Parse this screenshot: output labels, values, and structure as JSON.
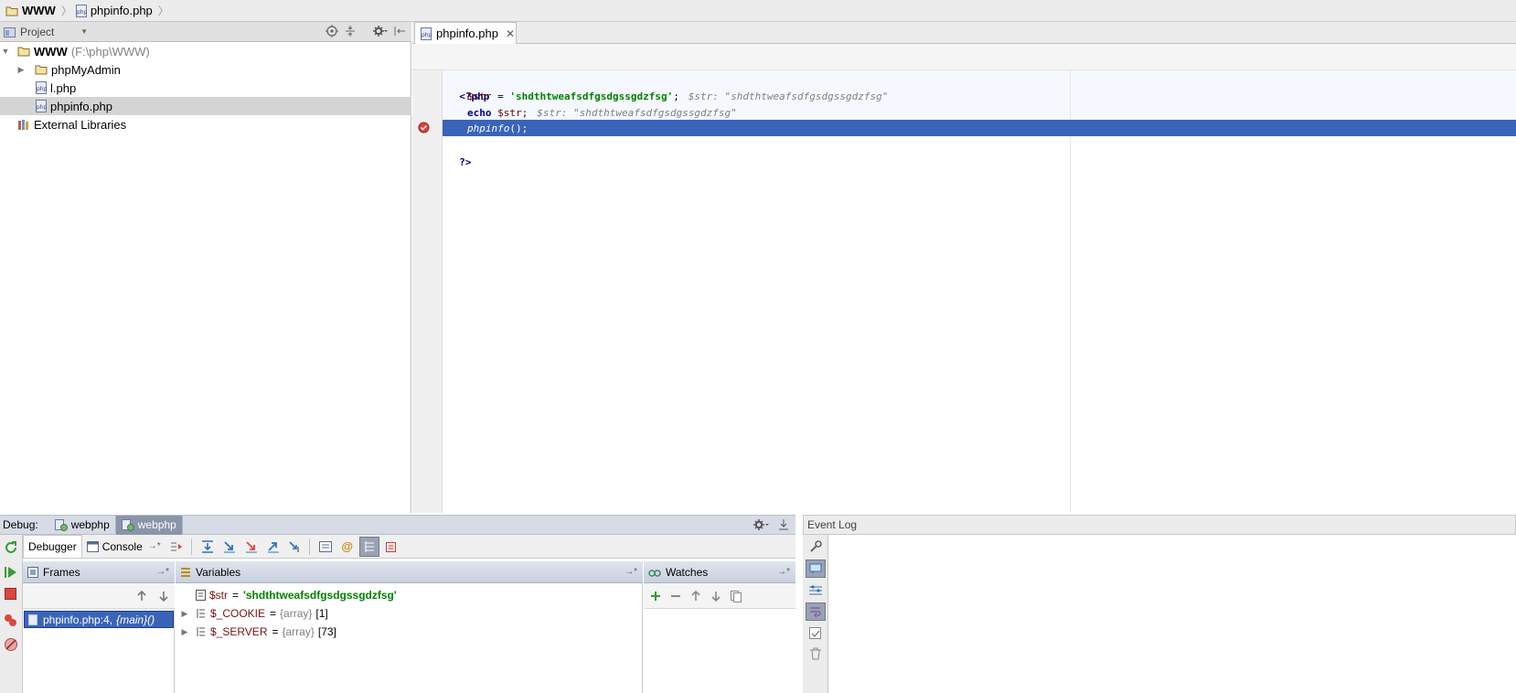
{
  "breadcrumb": {
    "root": "WWW",
    "file": "phpinfo.php"
  },
  "project": {
    "combo_label": "Project",
    "root": {
      "name": "WWW",
      "path": "(F:\\php\\WWW)"
    },
    "items": [
      {
        "label": "phpMyAdmin",
        "icon": "folder-icon"
      },
      {
        "label": "l.php",
        "icon": "php-file-icon"
      },
      {
        "label": "phpinfo.php",
        "icon": "php-file-icon",
        "selected": true
      }
    ],
    "external": "External Libraries"
  },
  "editor": {
    "tab_label": "phpinfo.php",
    "lines": {
      "open_tag": "<?php",
      "l2_var": "$str",
      "l2_eq": " = ",
      "l2_str": "'shdthtweafsdfgsdgssgdzfsg'",
      "l2_semi": ";",
      "l2_hint": "$str: \"shdthtweafsdfgsdgssgdzfsg\"",
      "l3_kw": "echo",
      "l3_var": " $str;",
      "l3_hint": "$str: \"shdthtweafsdfgsdgssgdzfsg\"",
      "l4_fn": "phpinfo",
      "l4_rest": "();",
      "close_tag": "?>"
    },
    "colors": {
      "highlight": "#3a64b8",
      "string": "#008000",
      "keyword": "#000080"
    }
  },
  "debug": {
    "label": "Debug:",
    "tabs": [
      "webphp",
      "webphp"
    ],
    "subtabs": {
      "debugger": "Debugger",
      "console": "Console"
    },
    "frames": {
      "title": "Frames",
      "row_file": "phpinfo.php:4,",
      "row_func": "{main}()"
    },
    "variables": {
      "title": "Variables",
      "rows": [
        {
          "name": "$str",
          "eq": "=",
          "value": "'shdthtweafsdfgsdgssgdzfsg'"
        },
        {
          "name": "$_COOKIE",
          "eq": "=",
          "type": "{array}",
          "value": "[1]"
        },
        {
          "name": "$_SERVER",
          "eq": "=",
          "type": "{array}",
          "value": "[73]"
        }
      ]
    },
    "watches": {
      "title": "Watches"
    }
  },
  "event_log": {
    "title": "Event Log"
  }
}
